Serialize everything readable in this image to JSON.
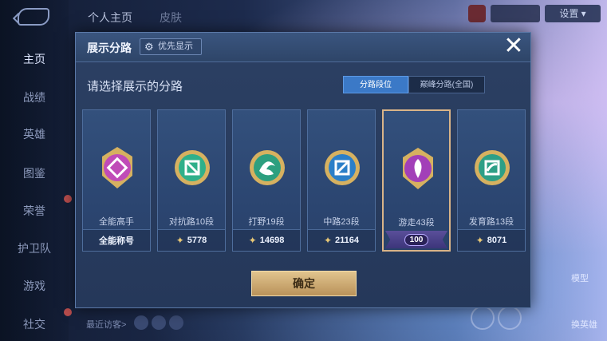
{
  "background": {
    "top_tabs": [
      "个人主页",
      "皮肤"
    ],
    "settings_label": "设置",
    "left_nav": [
      {
        "label": "主页",
        "active": true
      },
      {
        "label": "战绩",
        "active": false
      },
      {
        "label": "英雄",
        "active": false
      },
      {
        "label": "图鉴",
        "active": false
      },
      {
        "label": "荣誉",
        "active": false
      },
      {
        "label": "护卫队",
        "active": false
      },
      {
        "label": "游戏",
        "active": false
      },
      {
        "label": "社交",
        "active": false
      }
    ],
    "recent_visitors_label": "最近访客>",
    "right_buttons": [
      "模型",
      "换英雄"
    ]
  },
  "modal": {
    "title": "展示分路",
    "priority_label": "优先显示",
    "close_symbol": "✕",
    "prompt": "请选择展示的分路",
    "segments": [
      "分路段位",
      "巅峰分路(全国)"
    ],
    "active_segment": 0,
    "cards": [
      {
        "name": "全能高手",
        "footer": "全能称号",
        "score": null,
        "badge_color": "#c04bb8",
        "selected": false
      },
      {
        "name": "对抗路10段",
        "footer": null,
        "score": "5778",
        "badge_color": "#2fb08a",
        "selected": false
      },
      {
        "name": "打野19段",
        "footer": null,
        "score": "14698",
        "badge_color": "#2d9f7f",
        "selected": false
      },
      {
        "name": "中路23段",
        "footer": null,
        "score": "21164",
        "badge_color": "#2b7fc8",
        "selected": false
      },
      {
        "name": "游走43段",
        "footer": null,
        "score": "100",
        "badge_color": "#a23fb8",
        "selected": true
      },
      {
        "name": "发育路13段",
        "footer": null,
        "score": "8071",
        "badge_color": "#2d9f86",
        "selected": false
      }
    ],
    "confirm_label": "确定"
  }
}
